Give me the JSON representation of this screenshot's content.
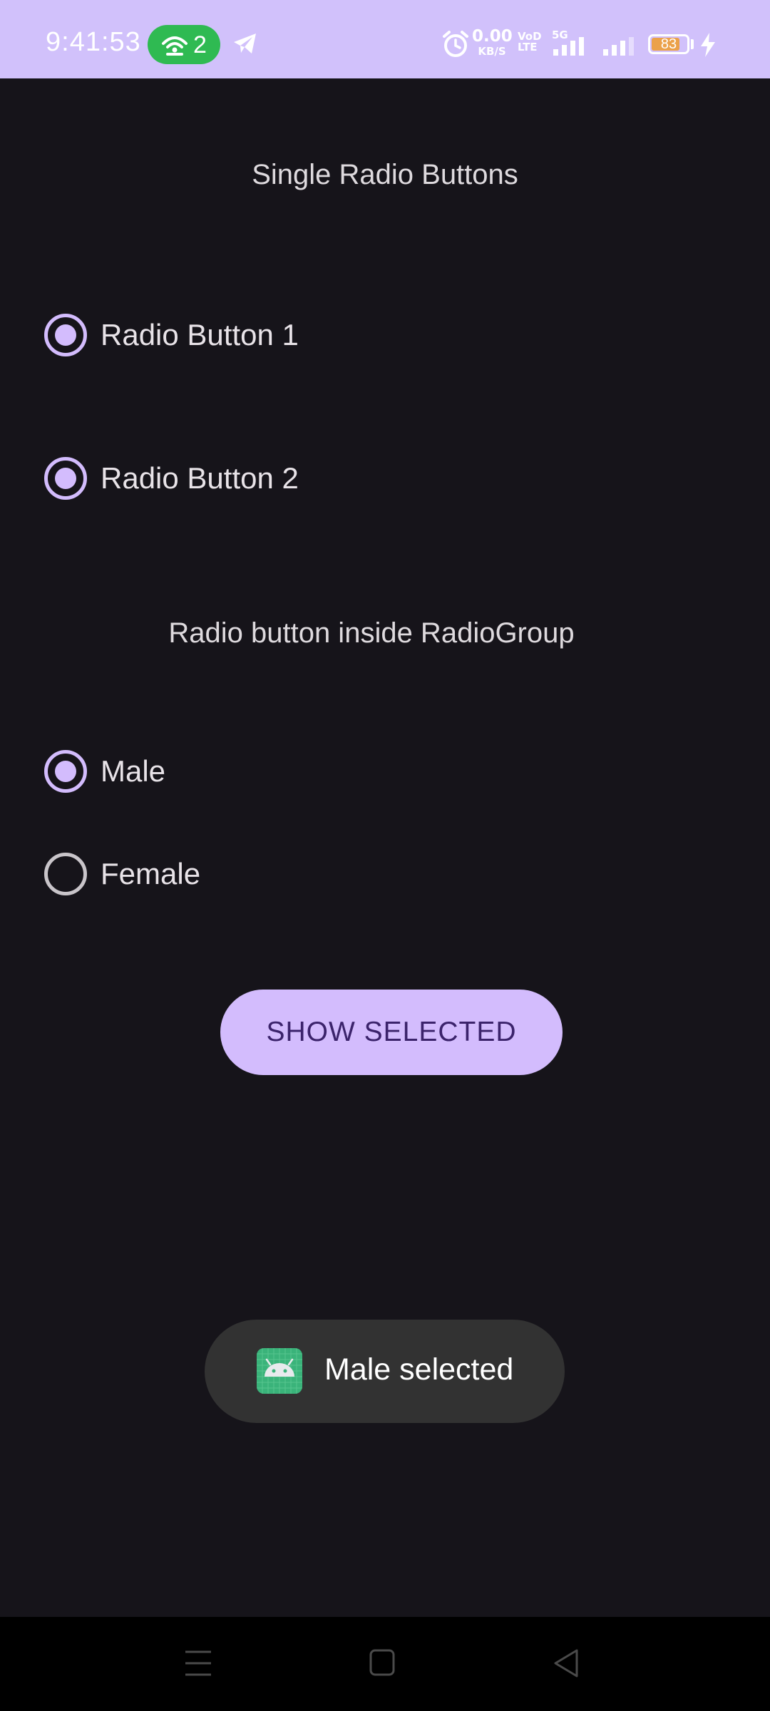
{
  "status_bar": {
    "time": "9:41:53",
    "hotspot_count": "2",
    "net_speed_value": "0.00",
    "net_speed_unit": "KB/S",
    "volte_top": "VoD",
    "volte_bottom": "LTE",
    "network_type": "5G",
    "battery_level": "83",
    "battery_fraction": 0.83,
    "accent_color": "#d1c1fb"
  },
  "content": {
    "single_heading": "Single Radio Buttons",
    "radio_1_label": "Radio Button 1",
    "radio_2_label": "Radio Button 2",
    "group_heading": "Radio button inside RadioGroup",
    "group_options": [
      {
        "label": "Male",
        "checked": true
      },
      {
        "label": "Female",
        "checked": false
      }
    ],
    "show_button_label": "SHOW SELECTED"
  },
  "toast": {
    "message": "Male selected"
  },
  "colors": {
    "background": "#16141a",
    "radio_accent": "#d3bcfd",
    "button_text": "#3b236b",
    "toast_bg": "#323232"
  }
}
